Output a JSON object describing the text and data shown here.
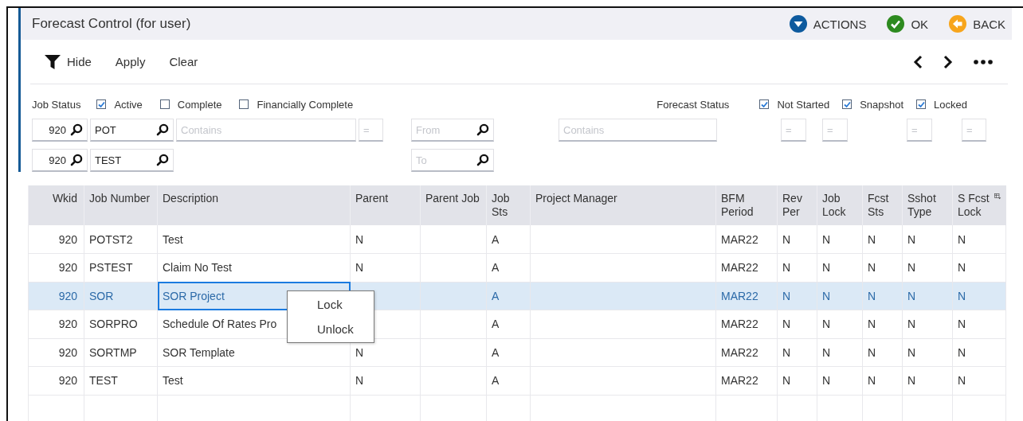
{
  "window": {
    "title": "Forecast Control (for user)"
  },
  "header_actions": [
    {
      "kind": "actions",
      "label": "ACTIONS"
    },
    {
      "kind": "ok",
      "label": "OK"
    },
    {
      "kind": "back",
      "label": "BACK"
    }
  ],
  "toolbar": {
    "hide": "Hide",
    "apply": "Apply",
    "clear": "Clear"
  },
  "job_status": {
    "label": "Job Status",
    "options": [
      {
        "label": "Active",
        "checked": true
      },
      {
        "label": "Complete",
        "checked": false
      },
      {
        "label": "Financially Complete",
        "checked": false
      }
    ]
  },
  "forecast_status": {
    "label": "Forecast Status",
    "options": [
      {
        "label": "Not Started",
        "checked": true
      },
      {
        "label": "Snapshot",
        "checked": true
      },
      {
        "label": "Locked",
        "checked": true
      }
    ]
  },
  "filter_row_1": [
    {
      "kind": "lookup",
      "value": "920"
    },
    {
      "kind": "lookup",
      "value": "POT"
    },
    {
      "kind": "text",
      "placeholder": "Contains"
    },
    {
      "kind": "text",
      "placeholder": "="
    },
    {
      "kind": "lookup",
      "placeholder": "From"
    },
    {
      "kind": "text",
      "placeholder": "Contains"
    },
    {
      "kind": "text",
      "placeholder": "="
    },
    {
      "kind": "text",
      "placeholder": "="
    },
    {
      "kind": "text",
      "placeholder": "="
    },
    {
      "kind": "text",
      "placeholder": "="
    }
  ],
  "filter_row_2": [
    {
      "kind": "lookup",
      "value": "920"
    },
    {
      "kind": "lookup",
      "value": "TEST"
    },
    {
      "kind": "lookup",
      "placeholder": "To"
    }
  ],
  "table": {
    "columns": [
      "Wkid",
      "Job Number",
      "Description",
      "Parent",
      "Parent Job",
      "Job Sts",
      "Project Manager",
      "BFM Period",
      "Rev Per",
      "Job Lock",
      "Fcst Sts",
      "Sshot Type",
      "S Fcst Lock"
    ],
    "rows": [
      {
        "selected": false,
        "focused": false,
        "cells": [
          "920",
          "POTST2",
          "Test",
          "N",
          null,
          "A",
          null,
          "MAR22",
          "N",
          "N",
          "N",
          "N",
          "N"
        ]
      },
      {
        "selected": false,
        "focused": false,
        "cells": [
          "920",
          "PSTEST",
          "Claim No Test",
          "N",
          null,
          "A",
          null,
          "MAR22",
          "N",
          "N",
          "N",
          "N",
          "N"
        ]
      },
      {
        "selected": true,
        "focused": true,
        "cells": [
          "920",
          "SOR",
          "SOR Project",
          null,
          null,
          "A",
          null,
          "MAR22",
          "N",
          "N",
          "N",
          "N",
          "N"
        ]
      },
      {
        "selected": false,
        "focused": false,
        "cells": [
          "920",
          "SORPRO",
          "Schedule Of Rates Pro",
          null,
          null,
          "A",
          null,
          "MAR22",
          "N",
          "N",
          "N",
          "N",
          "N"
        ]
      },
      {
        "selected": false,
        "focused": false,
        "cells": [
          "920",
          "SORTMP",
          "SOR Template",
          "N",
          null,
          "A",
          null,
          "MAR22",
          "N",
          "N",
          "N",
          "N",
          "N"
        ]
      },
      {
        "selected": false,
        "focused": false,
        "cells": [
          "920",
          "TEST",
          "Test",
          "N",
          null,
          "A",
          null,
          "MAR22",
          "N",
          "N",
          "N",
          "N",
          "N"
        ]
      }
    ]
  },
  "context_menu": [
    "Lock",
    "Unlock"
  ]
}
